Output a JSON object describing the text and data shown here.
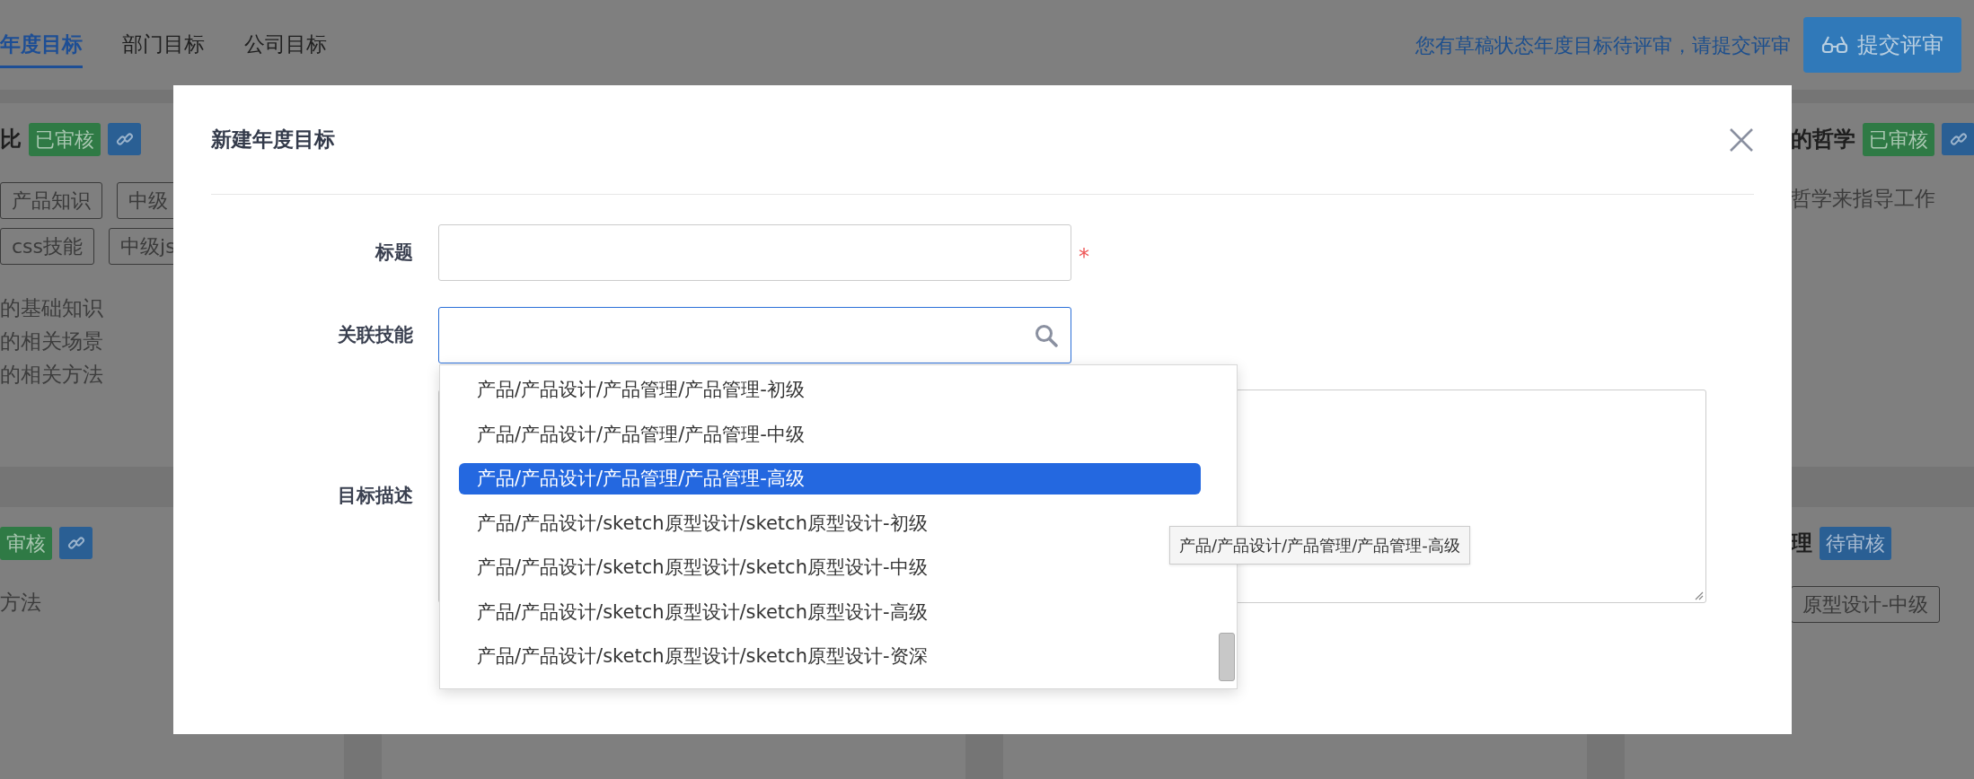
{
  "nav": {
    "tabs": [
      {
        "label": "年度目标",
        "selected": true
      },
      {
        "label": "部门目标",
        "selected": false
      },
      {
        "label": "公司目标",
        "selected": false
      }
    ],
    "notice": "您有草稿状态年度目标待评审，请提交评审",
    "submit_button": "提交评审"
  },
  "card_rows": [
    {
      "left": {
        "title": "比",
        "badge": {
          "label": "已审核",
          "kind": "approved"
        },
        "linked": true,
        "tag_rows": [
          [
            "产品知识",
            "中级"
          ],
          [
            "css技能",
            "中级js"
          ]
        ],
        "lines": [
          "的基础知识",
          "的相关场景",
          "的相关方法"
        ]
      },
      "right": {
        "title": "的哲学",
        "badge": {
          "label": "已审核",
          "kind": "approved"
        },
        "linked": true,
        "lines": [
          "哲学来指导工作"
        ]
      }
    },
    {
      "left": {
        "badge": {
          "label": "审核",
          "kind": "approved"
        },
        "linked": true,
        "lines": [
          "方法"
        ]
      },
      "right": {
        "title": "理",
        "badge": {
          "label": "待审核",
          "kind": "pending"
        },
        "linked": false,
        "tag_rows": [
          [
            "原型设计-中级"
          ]
        ]
      }
    }
  ],
  "dialog": {
    "title": "新建年度目标",
    "fields": [
      {
        "label": "标题",
        "kind": "text",
        "required_mark": "*",
        "focused": false
      },
      {
        "label": "关联技能",
        "kind": "search",
        "focused": true
      },
      {
        "label": "目标描述",
        "kind": "textarea",
        "focused": false
      }
    ],
    "dropdown": {
      "options": [
        {
          "label": "产品/产品设计/产品管理/产品管理-初级",
          "selected": false
        },
        {
          "label": "产品/产品设计/产品管理/产品管理-中级",
          "selected": false
        },
        {
          "label": "产品/产品设计/产品管理/产品管理-高级",
          "selected": true
        },
        {
          "label": "产品/产品设计/sketch原型设计/sketch原型设计-初级",
          "selected": false
        },
        {
          "label": "产品/产品设计/sketch原型设计/sketch原型设计-中级",
          "selected": false
        },
        {
          "label": "产品/产品设计/sketch原型设计/sketch原型设计-高级",
          "selected": false
        },
        {
          "label": "产品/产品设计/sketch原型设计/sketch原型设计-资深",
          "selected": false
        }
      ]
    },
    "tooltip": "产品/产品设计/产品管理/产品管理-高级"
  }
}
